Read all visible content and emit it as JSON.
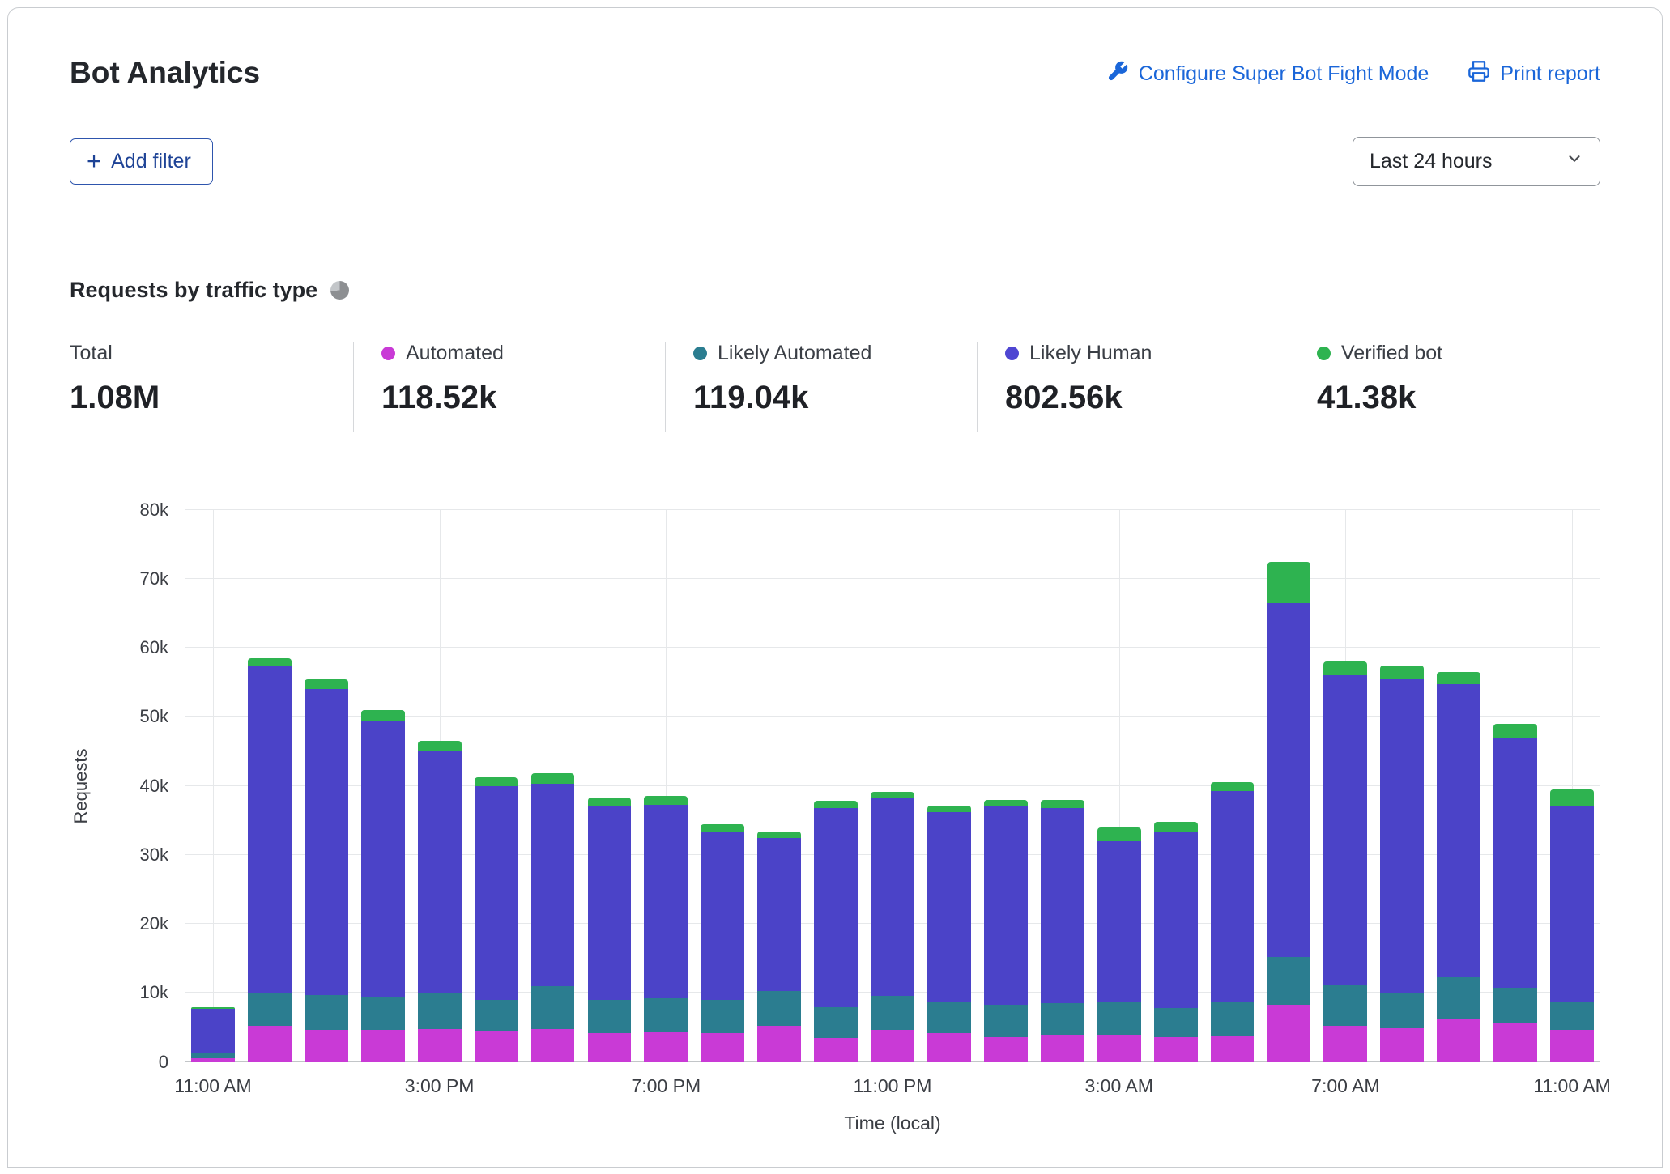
{
  "header": {
    "title": "Bot Analytics",
    "links": {
      "configure": "Configure Super Bot Fight Mode",
      "print": "Print report"
    },
    "add_filter_label": "Add filter",
    "time_range_value": "Last 24 hours"
  },
  "section": {
    "title": "Requests by traffic type"
  },
  "stats": [
    {
      "label": "Total",
      "value": "1.08M"
    },
    {
      "label": "Automated",
      "value": "118.52k",
      "color": "#c93ad6"
    },
    {
      "label": "Likely Automated",
      "value": "119.04k",
      "color": "#2b7d90"
    },
    {
      "label": "Likely Human",
      "value": "802.56k",
      "color": "#4f46d2"
    },
    {
      "label": "Verified bot",
      "value": "41.38k",
      "color": "#2eb350"
    }
  ],
  "chart_data": {
    "type": "bar",
    "stacked": true,
    "title": "Requests by traffic type",
    "xlabel": "Time (local)",
    "ylabel": "Requests",
    "ylim": [
      0,
      80000
    ],
    "ytick_step": 10000,
    "grid": true,
    "legend_position": "top",
    "x_tick_labels": [
      {
        "index": 0,
        "label": "11:00 AM"
      },
      {
        "index": 4,
        "label": "3:00 PM"
      },
      {
        "index": 8,
        "label": "7:00 PM"
      },
      {
        "index": 12,
        "label": "11:00 PM"
      },
      {
        "index": 16,
        "label": "3:00 AM"
      },
      {
        "index": 20,
        "label": "7:00 AM"
      },
      {
        "index": 24,
        "label": "11:00 AM"
      }
    ],
    "series": [
      {
        "name": "Automated",
        "color": "#c93ad6",
        "values": [
          500,
          5200,
          4700,
          4700,
          4800,
          4500,
          4800,
          4200,
          4300,
          4200,
          5200,
          3500,
          4600,
          4200,
          3600,
          4000,
          4000,
          3600,
          3800,
          8300,
          5200,
          4900,
          6300,
          5600,
          4700
        ]
      },
      {
        "name": "Likely Automated",
        "color": "#2b7d90",
        "values": [
          700,
          4800,
          5000,
          4800,
          5200,
          4500,
          6200,
          4800,
          4900,
          4800,
          5100,
          4500,
          5000,
          4400,
          4700,
          4500,
          4700,
          4200,
          5000,
          6900,
          6000,
          5100,
          6000,
          5200,
          4000
        ]
      },
      {
        "name": "Likely Human",
        "color": "#4b43c8",
        "values": [
          6500,
          47500,
          44300,
          40000,
          35000,
          31000,
          29300,
          28000,
          28100,
          24300,
          22200,
          28800,
          28700,
          27600,
          28700,
          28300,
          23300,
          25500,
          30500,
          51300,
          44800,
          45500,
          42400,
          36200,
          28300
        ]
      },
      {
        "name": "Verified bot",
        "color": "#2eb350",
        "values": [
          300,
          1000,
          1500,
          1500,
          1500,
          1300,
          1500,
          1300,
          1300,
          1100,
          900,
          1000,
          800,
          1000,
          1000,
          1200,
          2000,
          1500,
          1200,
          6000,
          2000,
          2000,
          1800,
          2000,
          2500
        ]
      }
    ]
  }
}
